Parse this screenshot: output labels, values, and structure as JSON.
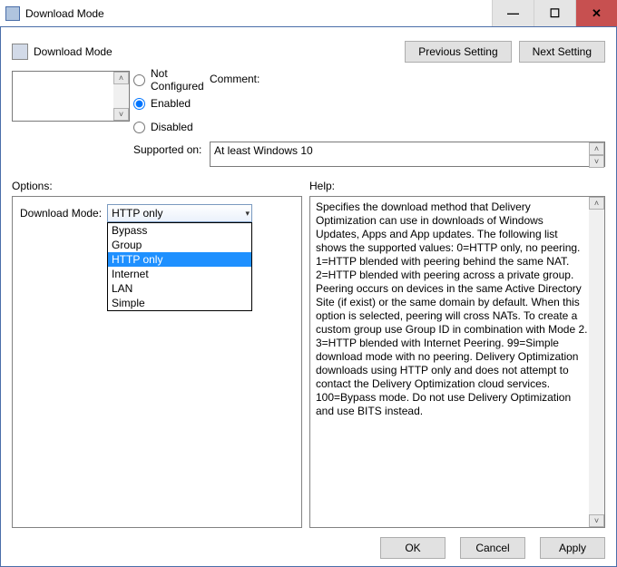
{
  "window": {
    "title": "Download Mode"
  },
  "header": {
    "title": "Download Mode",
    "prev": "Previous Setting",
    "next": "Next Setting"
  },
  "state": {
    "not_configured": "Not Configured",
    "enabled": "Enabled",
    "disabled": "Disabled",
    "selected": "enabled"
  },
  "fields": {
    "comment_label": "Comment:",
    "comment_value": "",
    "supported_label": "Supported on:",
    "supported_value": "At least Windows 10"
  },
  "sections": {
    "options": "Options:",
    "help": "Help:"
  },
  "options": {
    "label": "Download Mode:",
    "selected": "HTTP only",
    "items": [
      "Bypass",
      "Group",
      "HTTP only",
      "Internet",
      "LAN",
      "Simple"
    ]
  },
  "help_text": "Specifies the download method that Delivery Optimization can use in downloads of Windows Updates, Apps and App updates. The following list shows the supported values: 0=HTTP only, no peering. 1=HTTP blended with peering behind the same NAT. 2=HTTP blended with peering across a private group. Peering occurs on devices in the same Active Directory Site (if exist) or the same domain by default. When this option is selected, peering will cross NATs. To create a custom group use Group ID in combination with Mode 2. 3=HTTP blended with Internet Peering. 99=Simple download mode with no peering. Delivery Optimization downloads using HTTP only and does not attempt to contact the Delivery Optimization cloud services. 100=Bypass mode. Do not use Delivery Optimization and use BITS instead.",
  "footer": {
    "ok": "OK",
    "cancel": "Cancel",
    "apply": "Apply"
  },
  "glyphs": {
    "min": "—",
    "max": "☐",
    "close": "✕",
    "up": "˄",
    "down": "˅",
    "tri": "▾"
  }
}
